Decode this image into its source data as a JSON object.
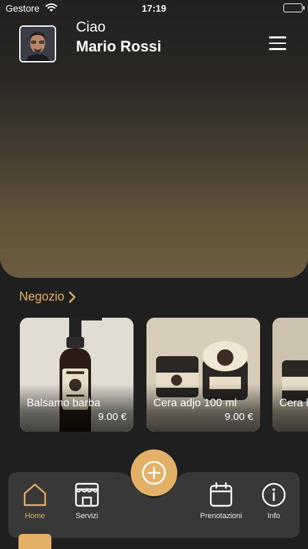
{
  "status_bar": {
    "carrier": "Gestore",
    "time": "17:19"
  },
  "header": {
    "greeting": "Ciao",
    "user_name": "Mario Rossi",
    "menu_icon": "hamburger-menu-icon"
  },
  "shop": {
    "title": "Negozio",
    "products": [
      {
        "name": "Balsamo barba",
        "price": "9.00 €"
      },
      {
        "name": "Cera adjo 100 ml",
        "price": "9.00 €"
      },
      {
        "name": "Cera l",
        "price": ""
      }
    ]
  },
  "nav": {
    "items": [
      {
        "label": "Home",
        "icon": "home-icon",
        "active": true
      },
      {
        "label": "Servizi",
        "icon": "shop-icon"
      },
      {
        "label": "Prenotazioni",
        "icon": "calendar-icon"
      },
      {
        "label": "Info",
        "icon": "info-icon"
      }
    ],
    "fab_icon": "plus-circle-icon"
  },
  "colors": {
    "accent": "#e3b067",
    "background": "#1f1f1f",
    "navbar": "#383838"
  }
}
